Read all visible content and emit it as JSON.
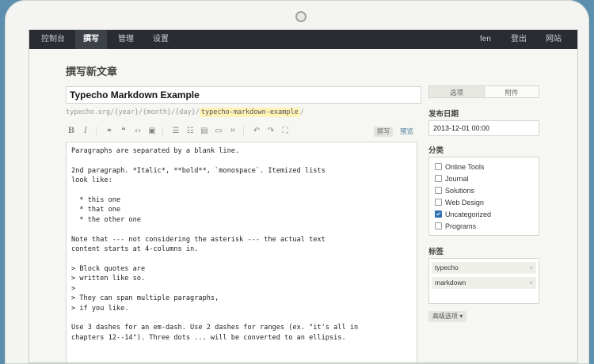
{
  "nav": {
    "items": [
      "控制台",
      "撰写",
      "管理",
      "设置"
    ],
    "right_items": [
      "fen",
      "登出",
      "网站"
    ]
  },
  "page_title": "撰写新文章",
  "post": {
    "title": "Typecho Markdown Example",
    "slug_prefix": "typecho.org/{year}/{month}/{day}/",
    "slug": "typecho-markdown-example",
    "slug_suffix": "/"
  },
  "toolbar": {
    "icons": [
      "bold-icon",
      "italic-icon",
      "link-icon",
      "quote-icon",
      "code-icon",
      "image-icon",
      "ordered-list-icon",
      "unordered-list-icon",
      "heading-icon",
      "horizontal-rule-icon",
      "more-icon",
      "undo-icon",
      "redo-icon",
      "fullscreen-icon"
    ],
    "write_label": "撰写",
    "preview_label": "预览"
  },
  "editor": {
    "content": "Paragraphs are separated by a blank line.\n\n2nd paragraph. *Italic*, **bold**, `monospace`. Itemized lists\nlook like:\n\n  * this one\n  * that one\n  * the other one\n\nNote that --- not considering the asterisk --- the actual text\ncontent starts at 4-columns in.\n\n> Block quotes are\n> written like so.\n>\n> They can span multiple paragraphs,\n> if you like.\n\nUse 3 dashes for an em-dash. Use 2 dashes for ranges (ex. \"it's all in\nchapters 12--14\"). Three dots ... will be converted to an ellipsis."
  },
  "sidebar": {
    "tabs": [
      "选项",
      "附件"
    ],
    "date_label": "发布日期",
    "date_value": "2013-12-01 00:00",
    "category_label": "分类",
    "categories": [
      {
        "name": "Online Tools",
        "checked": false
      },
      {
        "name": "Journal",
        "checked": false
      },
      {
        "name": "Solutions",
        "checked": false
      },
      {
        "name": "Web Design",
        "checked": false
      },
      {
        "name": "Uncategorized",
        "checked": true
      },
      {
        "name": "Programs",
        "checked": false
      }
    ],
    "tags_label": "标签",
    "tags": [
      "typecho",
      "markdown"
    ],
    "tag_remove": "×",
    "advanced_label": "高级选项 ▾"
  }
}
